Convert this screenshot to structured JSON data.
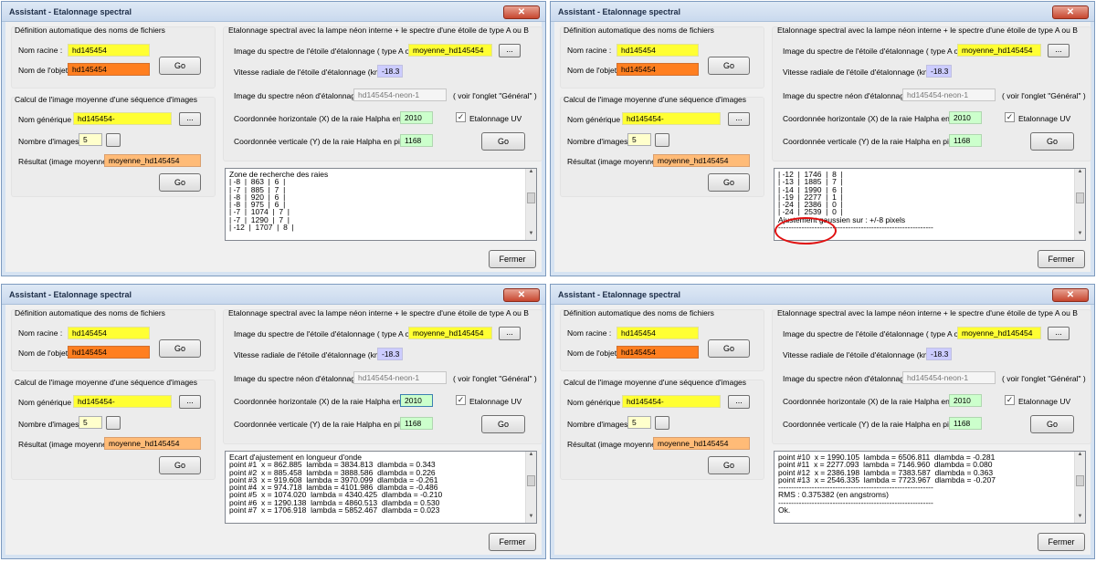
{
  "windows": [
    {
      "title": "Assistant - Etalonnage spectral",
      "file_group_title": "Définition automatique des noms de fichiers",
      "root_label": "Nom racine :",
      "root_value": "hd145454",
      "object_label": "Nom de l'objet :",
      "object_value": "hd145454",
      "go1": "Go",
      "avg_group_title": "Calcul de l'image moyenne d'une séquence d'images",
      "generic_label": "Nom générique :",
      "generic_value": "hd145454-",
      "count_label": "Nombre d'images :",
      "count_value": "5",
      "result_label": "Résultat (image moyenne) :",
      "result_value": "moyenne_hd145454",
      "go2": "Go",
      "calib_title": "Etalonnage spectral avec la lampe néon interne + le spectre d'une étoile de type A ou B",
      "star_label": "Image du spectre de l'étoile d'étalonnage ( type A ou B ) :",
      "star_value": "moyenne_hd145454",
      "rv_label": "Vitesse radiale de l'étoile d'étalonnage  (km/s ) :",
      "rv_value": "-18.3",
      "neon_label": "Image du spectre néon d'étalonnage :",
      "neon_value": "hd145454-neon-1",
      "neon_note": "( voir l'onglet \"Général\" )",
      "xcoord_label": "Coordonnée horizontale (X) de la raie Halpha en pixels :",
      "xcoord_value": "2010",
      "uv_label": "Etalonnage UV",
      "ycoord_label": "Coordonnée verticale (Y) de la raie Halpha en pixels :",
      "ycoord_value": "1168",
      "go3": "Go",
      "close": "Fermer",
      "log_lines": [
        "Zone de recherche des raies",
        "| -8  |  863  |  6  |",
        "| -7  |  885  |  7  |",
        "| -8  |  920  |  6  |",
        "| -8  |  975  |  6  |",
        "| -7  |  1074  |  7  |",
        "| -7  |  1290  |  7  |",
        "| -12  |  1707  |  8  |"
      ]
    },
    {
      "title": "Assistant - Etalonnage spectral",
      "file_group_title": "Définition automatique des noms de fichiers",
      "root_label": "Nom racine :",
      "root_value": "hd145454",
      "object_label": "Nom de l'objet :",
      "object_value": "hd145454",
      "go1": "Go",
      "avg_group_title": "Calcul de l'image moyenne d'une séquence d'images",
      "generic_label": "Nom générique :",
      "generic_value": "hd145454-",
      "count_label": "Nombre d'images :",
      "count_value": "5",
      "result_label": "Résultat (image moyenne) :",
      "result_value": "moyenne_hd145454",
      "go2": "Go",
      "calib_title": "Etalonnage spectral avec la lampe néon interne + le spectre d'une étoile de type A ou B",
      "star_label": "Image du spectre de l'étoile d'étalonnage ( type A ou B ) :",
      "star_value": "moyenne_hd145454",
      "rv_label": "Vitesse radiale de l'étoile d'étalonnage  (km/s ) :",
      "rv_value": "-18.3",
      "neon_label": "Image du spectre néon d'étalonnage :",
      "neon_value": "hd145454-neon-1",
      "neon_note": "( voir l'onglet \"Général\" )",
      "xcoord_label": "Coordonnée horizontale (X) de la raie Halpha en pixels :",
      "xcoord_value": "2010",
      "uv_label": "Etalonnage UV",
      "ycoord_label": "Coordonnée verticale (Y) de la raie Halpha en pixels :",
      "ycoord_value": "1168",
      "go3": "Go",
      "close": "Fermer",
      "log_lines": [
        "| -12  |  1746  |  8  |",
        "| -13  |  1885  |  7  |",
        "| -14  |  1990  |  6  |",
        "| -19  |  2277  |  1  |",
        "| -24  |  2386  |  0  |",
        "| -24  |  2539  |  0  |",
        "Ajustement gaussien sur : +/-8 pixels",
        "------------------------------------------------------------"
      ]
    },
    {
      "title": "Assistant - Etalonnage spectral",
      "file_group_title": "Définition automatique des noms de fichiers",
      "root_label": "Nom racine :",
      "root_value": "hd145454",
      "object_label": "Nom de l'objet :",
      "object_value": "hd145454",
      "go1": "Go",
      "avg_group_title": "Calcul de l'image moyenne d'une séquence d'images",
      "generic_label": "Nom générique :",
      "generic_value": "hd145454-",
      "count_label": "Nombre d'images :",
      "count_value": "5",
      "result_label": "Résultat (image moyenne) :",
      "result_value": "moyenne_hd145454",
      "go2": "Go",
      "calib_title": "Etalonnage spectral avec la lampe néon interne + le spectre d'une étoile de type A ou B",
      "star_label": "Image du spectre de l'étoile d'étalonnage ( type A ou B ) :",
      "star_value": "moyenne_hd145454",
      "rv_label": "Vitesse radiale de l'étoile d'étalonnage  (km/s ) :",
      "rv_value": "-18.3",
      "neon_label": "Image du spectre néon d'étalonnage :",
      "neon_value": "hd145454-neon-1",
      "neon_note": "( voir l'onglet \"Général\" )",
      "xcoord_label": "Coordonnée horizontale (X) de la raie Halpha en pixels :",
      "xcoord_value": "2010",
      "uv_label": "Etalonnage UV",
      "ycoord_label": "Coordonnée verticale (Y) de la raie Halpha en pixels :",
      "ycoord_value": "1168",
      "go3": "Go",
      "close": "Fermer",
      "log_lines": [
        "Ecart d'ajustement en longueur d'onde",
        "point #1  x = 862.885  lambda = 3834.813  dlambda = 0.343",
        "point #2  x = 885.458  lambda = 3888.586  dlambda = 0.226",
        "point #3  x = 919.608  lambda = 3970.099  dlambda = -0.261",
        "point #4  x = 974.718  lambda = 4101.986  dlambda = -0.486",
        "point #5  x = 1074.020  lambda = 4340.425  dlambda = -0.210",
        "point #6  x = 1290.138  lambda = 4860.513  dlambda = 0.530",
        "point #7  x = 1706.918  lambda = 5852.467  dlambda = 0.023"
      ]
    },
    {
      "title": "Assistant - Etalonnage spectral",
      "file_group_title": "Définition automatique des noms de fichiers",
      "root_label": "Nom racine :",
      "root_value": "hd145454",
      "object_label": "Nom de l'objet :",
      "object_value": "hd145454",
      "go1": "Go",
      "avg_group_title": "Calcul de l'image moyenne d'une séquence d'images",
      "generic_label": "Nom générique :",
      "generic_value": "hd145454-",
      "count_label": "Nombre d'images :",
      "count_value": "5",
      "result_label": "Résultat (image moyenne) :",
      "result_value": "moyenne_hd145454",
      "go2": "Go",
      "calib_title": "Etalonnage spectral avec la lampe néon interne + le spectre d'une étoile de type A ou B",
      "star_label": "Image du spectre de l'étoile d'étalonnage ( type A ou B ) :",
      "star_value": "moyenne_hd145454",
      "rv_label": "Vitesse radiale de l'étoile d'étalonnage  (km/s ) :",
      "rv_value": "-18.3",
      "neon_label": "Image du spectre néon d'étalonnage :",
      "neon_value": "hd145454-neon-1",
      "neon_note": "( voir l'onglet \"Général\" )",
      "xcoord_label": "Coordonnée horizontale (X) de la raie Halpha en pixels :",
      "xcoord_value": "2010",
      "uv_label": "Etalonnage UV",
      "ycoord_label": "Coordonnée verticale (Y) de la raie Halpha en pixels :",
      "ycoord_value": "1168",
      "go3": "Go",
      "close": "Fermer",
      "log_lines": [
        "point #10  x = 1990.105  lambda = 6506.811  dlambda = -0.281",
        "point #11  x = 2277.093  lambda = 7146.960  dlambda = 0.080",
        "point #12  x = 2386.198  lambda = 7383.587  dlambda = 0.363",
        "point #13  x = 2546.335  lambda = 7723.967  dlambda = -0.207",
        "------------------------------------------------------------",
        "RMS : 0.375382 (en angstroms)",
        "------------------------------------------------------------",
        "Ok."
      ]
    }
  ],
  "colors": {
    "yellow": "#ffff33",
    "orange": "#ff7f20",
    "lavender": "#ccccff",
    "lightgreen": "#ccffcc",
    "peach": "#ffbb77",
    "highlight": "#e01010"
  }
}
